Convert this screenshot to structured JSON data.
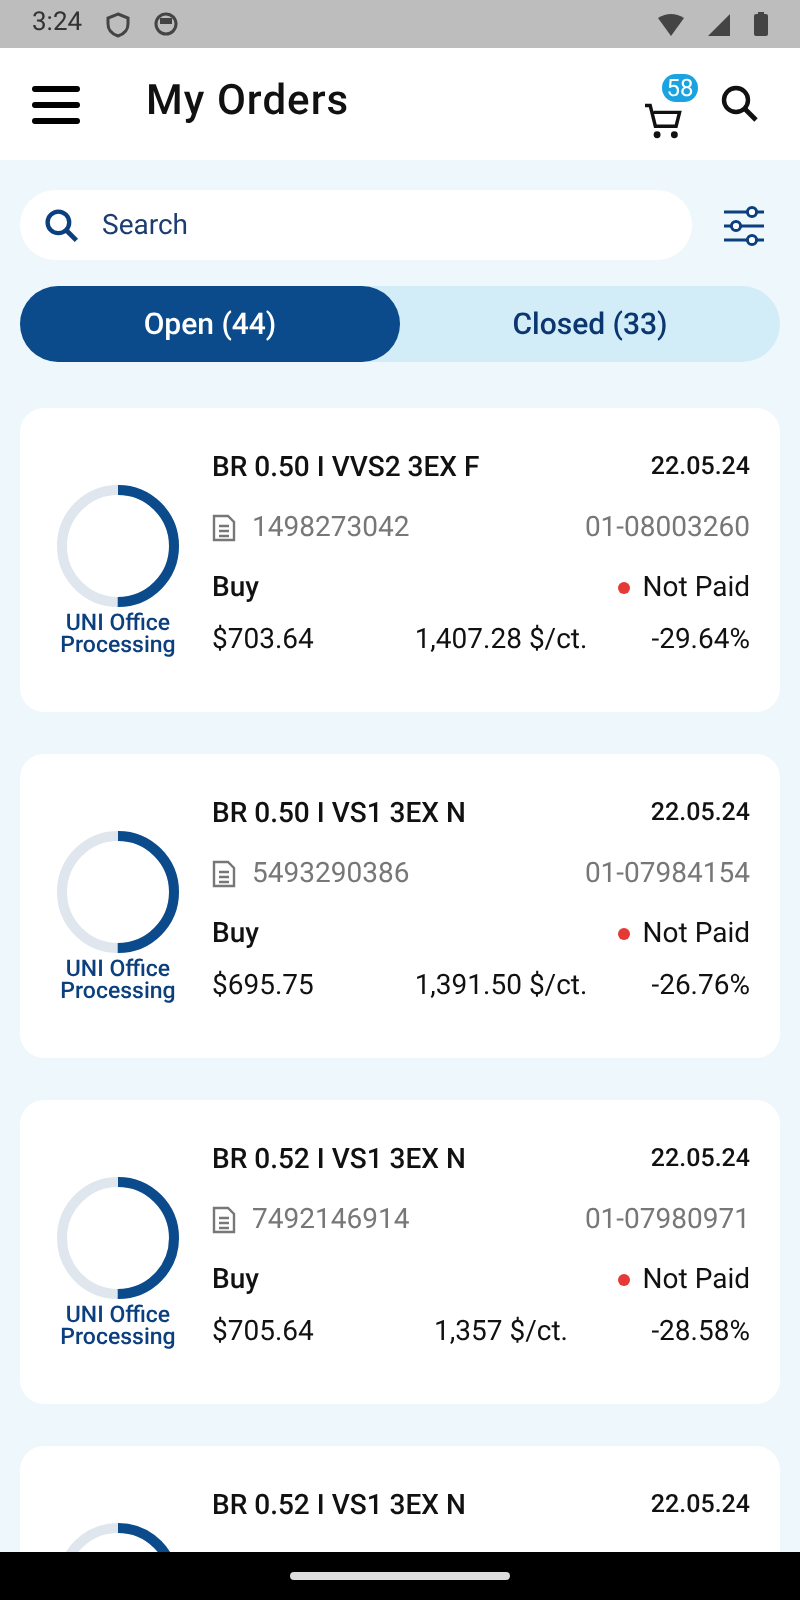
{
  "status_bar": {
    "time": "3:24"
  },
  "header": {
    "title": "My Orders",
    "cart_count": "58"
  },
  "search": {
    "placeholder": "Search"
  },
  "tabs": [
    {
      "label": "Open (44)",
      "selected": true
    },
    {
      "label": "Closed (33)",
      "selected": false
    }
  ],
  "orders": [
    {
      "title": "BR 0.50 I VVS2 3EX F",
      "date": "22.05.24",
      "doc_number": "1498273042",
      "order_number": "01-08003260",
      "type": "Buy",
      "payment": "Not Paid",
      "price": "$703.64",
      "price_per_carat": "1,407.28 $/ct.",
      "discount": "-29.64%",
      "status": "UNI Office Processing"
    },
    {
      "title": "BR 0.50 I VS1 3EX N",
      "date": "22.05.24",
      "doc_number": "5493290386",
      "order_number": "01-07984154",
      "type": "Buy",
      "payment": "Not Paid",
      "price": "$695.75",
      "price_per_carat": "1,391.50 $/ct.",
      "discount": "-26.76%",
      "status": "UNI Office Processing"
    },
    {
      "title": "BR 0.52 I VS1 3EX N",
      "date": "22.05.24",
      "doc_number": "7492146914",
      "order_number": "01-07980971",
      "type": "Buy",
      "payment": "Not Paid",
      "price": "$705.64",
      "price_per_carat": "1,357 $/ct.",
      "discount": "-28.58%",
      "status": "UNI Office Processing"
    },
    {
      "title": "BR 0.52 I VS1 3EX N",
      "date": "22.05.24"
    }
  ]
}
